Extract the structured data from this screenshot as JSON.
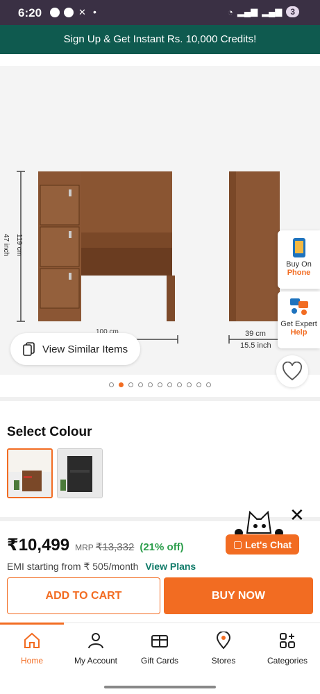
{
  "status_bar": {
    "time": "6:20",
    "battery": "3"
  },
  "banner": {
    "text": "Sign Up & Get Instant Rs. 10,000 Credits!"
  },
  "gallery": {
    "height_label": "119 cm",
    "height_label_inch": "47 inch",
    "width_label": "100 cm",
    "depth_label": "39 cm",
    "depth_label_inch": "15.5 inch",
    "view_similar": "View Similar Items",
    "slides": 11,
    "active_slide": 1
  },
  "side_actions": {
    "buy_on_phone": {
      "line1": "Buy On",
      "line2": "Phone"
    },
    "expert_help": {
      "line1": "Get Expert",
      "line2": "Help"
    }
  },
  "colour": {
    "title": "Select Colour",
    "options": [
      "brown-walnut",
      "black"
    ]
  },
  "pricing": {
    "price": "₹10,499",
    "mrp_label": "MRP",
    "mrp_value": "₹13,332",
    "discount": "(21% off)",
    "emi_text": "EMI starting from ₹ 505/month",
    "emi_link": "View Plans"
  },
  "actions": {
    "add_to_cart": "ADD TO CART",
    "buy_now": "BUY NOW"
  },
  "chat": {
    "label": "Let's Chat"
  },
  "bottom_nav": [
    {
      "label": "Home",
      "icon": "home-icon"
    },
    {
      "label": "My Account",
      "icon": "user-icon"
    },
    {
      "label": "Gift Cards",
      "icon": "gift-card-icon"
    },
    {
      "label": "Stores",
      "icon": "store-pin-icon"
    },
    {
      "label": "Categories",
      "icon": "categories-icon"
    }
  ],
  "colors": {
    "accent": "#f26c22",
    "banner": "#0f5a4f",
    "status_bar": "#3a3044",
    "discount": "#2a9d4a"
  }
}
